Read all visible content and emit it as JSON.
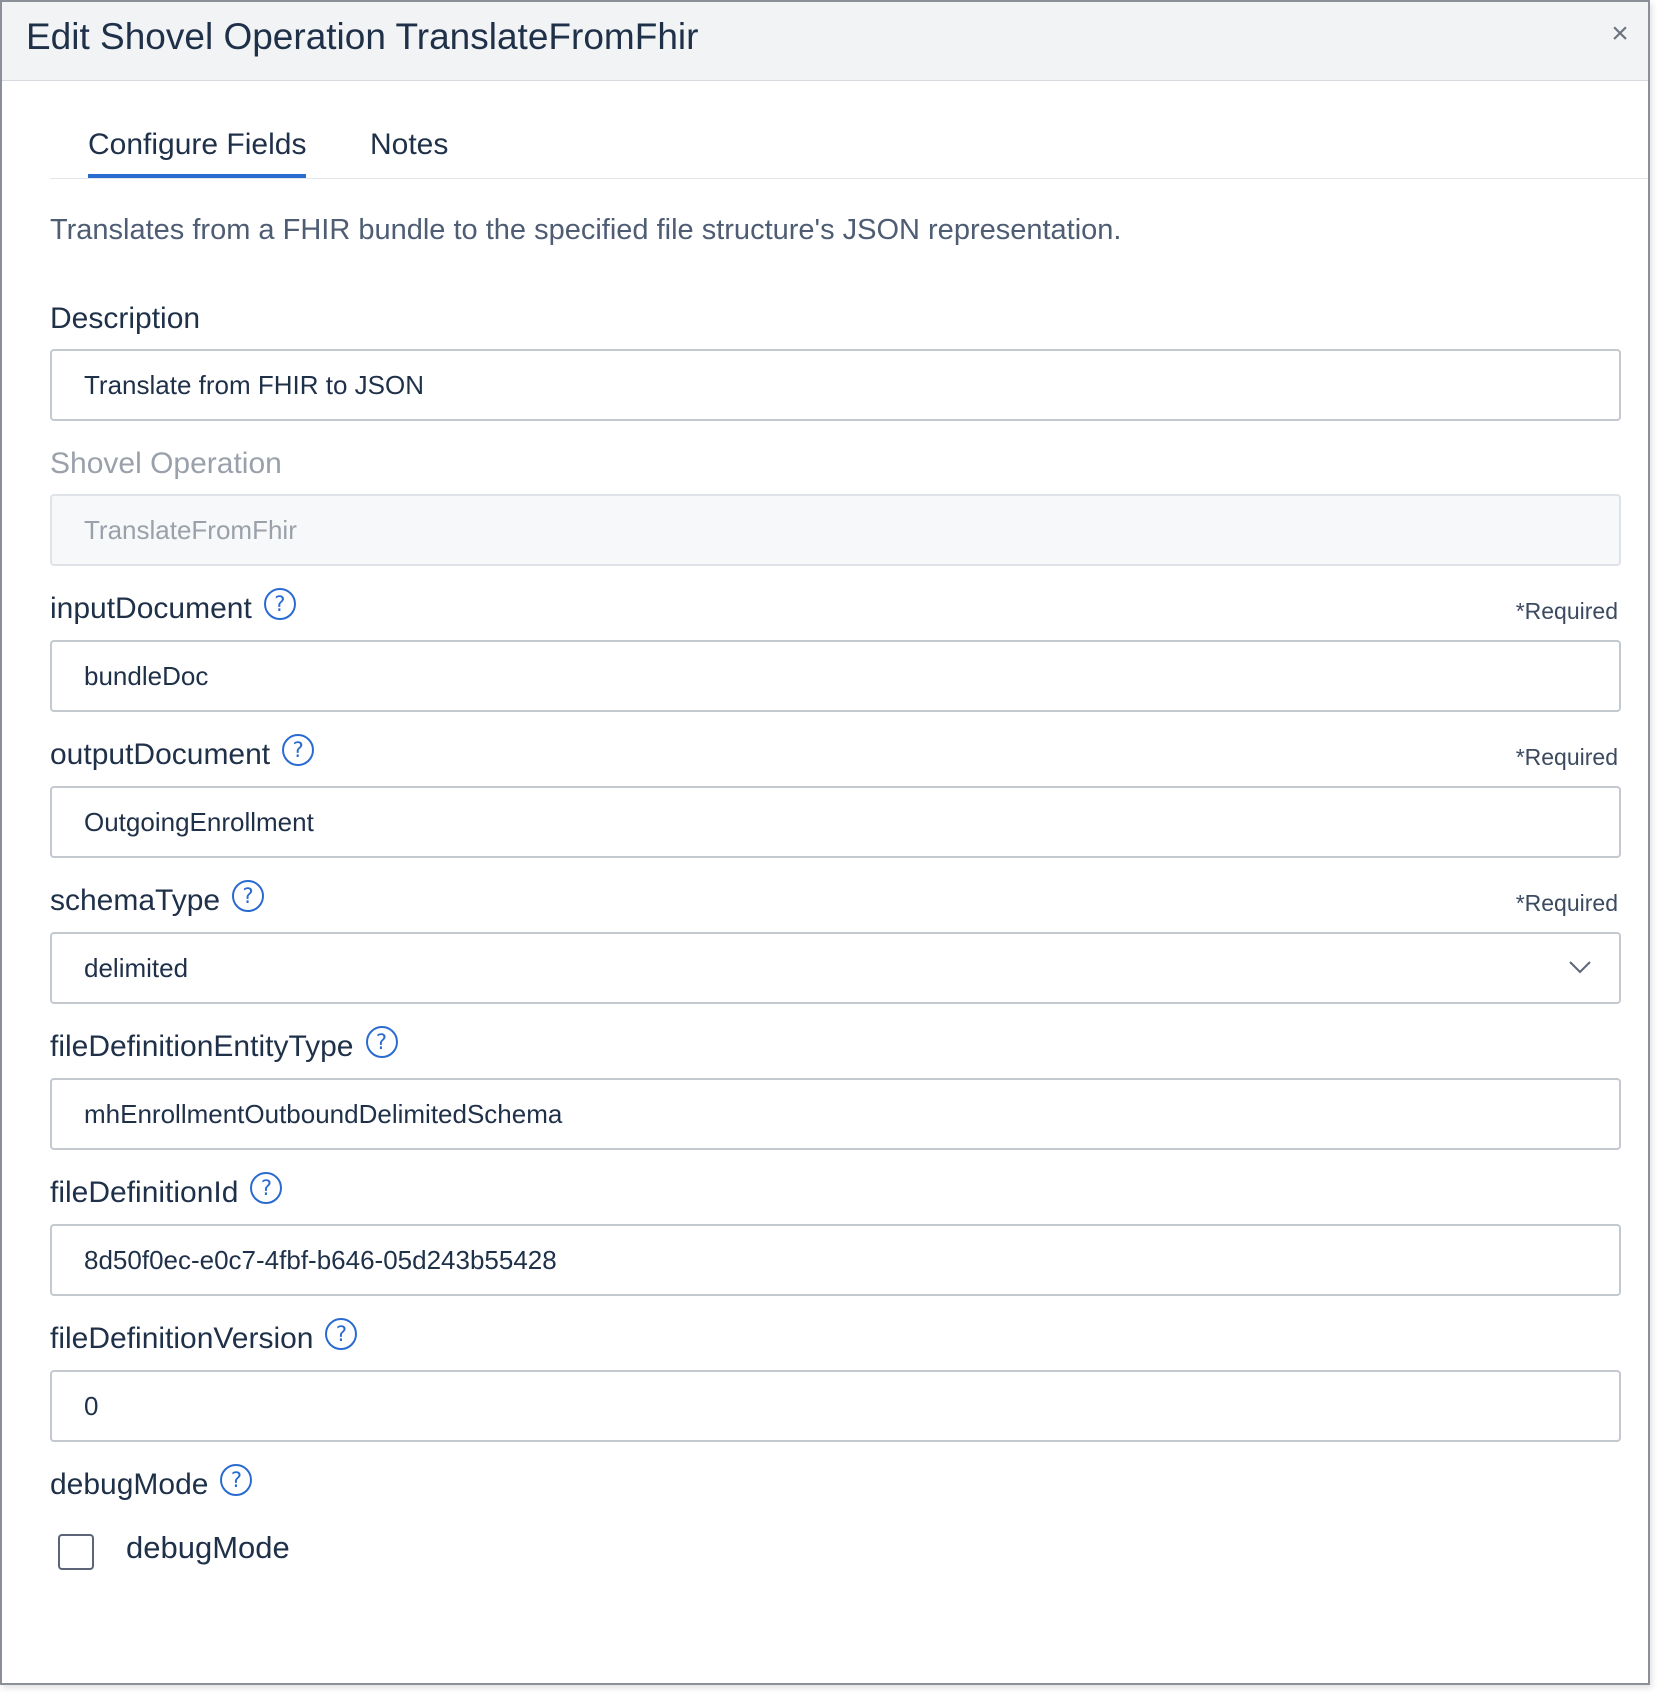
{
  "dialog": {
    "title": "Edit Shovel Operation TranslateFromFhir",
    "close_glyph": "×"
  },
  "tabs": [
    {
      "label": "Configure Fields",
      "active": true
    },
    {
      "label": "Notes",
      "active": false
    }
  ],
  "intro": "Translates from a FHIR bundle to the specified file structure's JSON representation.",
  "required_text": "*Required",
  "help_glyph": "?",
  "fields": {
    "description": {
      "label": "Description",
      "value": "Translate from FHIR to JSON"
    },
    "shovel_operation": {
      "label": "Shovel Operation",
      "value": "TranslateFromFhir",
      "disabled": true
    },
    "input_document": {
      "label": "inputDocument",
      "value": "bundleDoc",
      "required": true
    },
    "output_document": {
      "label": "outputDocument",
      "value": "OutgoingEnrollment",
      "required": true
    },
    "schema_type": {
      "label": "schemaType",
      "value": "delimited",
      "required": true,
      "icon": "chevron-down-icon"
    },
    "file_definition_entity_type": {
      "label": "fileDefinitionEntityType",
      "value": "mhEnrollmentOutboundDelimitedSchema"
    },
    "file_definition_id": {
      "label": "fileDefinitionId",
      "value": "8d50f0ec-e0c7-4fbf-b646-05d243b55428"
    },
    "file_definition_version": {
      "label": "fileDefinitionVersion",
      "value": "0"
    },
    "debug_mode": {
      "label": "debugMode",
      "checkbox_label": "debugMode",
      "checked": false
    }
  },
  "colors": {
    "accent": "#2a6bd1",
    "text": "#1f3049",
    "header_bg": "#f1f3f5"
  }
}
